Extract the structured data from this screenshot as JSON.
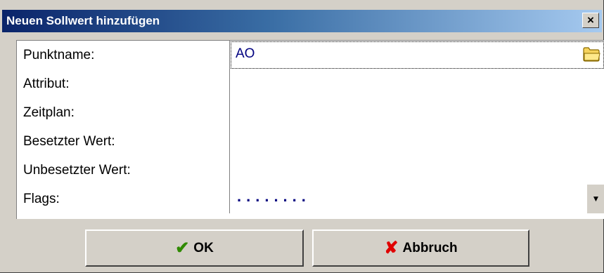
{
  "dialog": {
    "title": "Neuen Sollwert hinzufügen",
    "close_label": "×"
  },
  "fields": [
    {
      "label": "Punktname:",
      "value": "AO"
    },
    {
      "label": "Attribut:",
      "value": ""
    },
    {
      "label": "Zeitplan:",
      "value": ""
    },
    {
      "label": "Besetzter Wert:",
      "value": ""
    },
    {
      "label": "Unbesetzter Wert:",
      "value": ""
    },
    {
      "label": "Flags:",
      "value": "........"
    }
  ],
  "icons": {
    "folder": "folder-icon",
    "dropdown": "▼",
    "ok": "✔",
    "cancel": "✘"
  },
  "buttons": {
    "ok_label": "OK",
    "cancel_label": "Abbruch"
  },
  "colors": {
    "title_gradient_start": "#0a246a",
    "title_gradient_end": "#a6caf0",
    "value_text": "#000080",
    "ok_icon": "#2f8a00",
    "cancel_icon": "#e00000"
  }
}
